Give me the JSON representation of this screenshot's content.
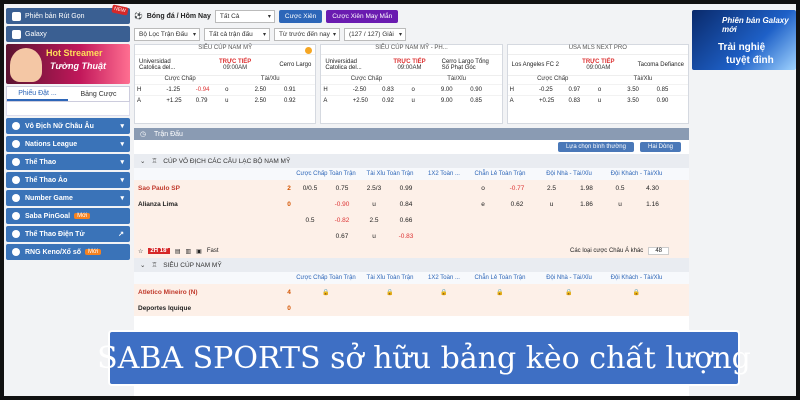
{
  "sidebar": {
    "promo_top": "Phiên bản Rút Gọn",
    "promo_new": "NEW",
    "galaxy": "Galaxy",
    "banner": {
      "line1": "Hot Streamer",
      "line2": "Tường Thuật"
    },
    "tabs": [
      "Phiếu Đặt ...",
      "Bảng Cược"
    ],
    "items": [
      {
        "label": "Vô Địch Nữ Châu Âu",
        "tag": ""
      },
      {
        "label": "Nations League",
        "tag": ""
      },
      {
        "label": "Thể Thao",
        "tag": ""
      },
      {
        "label": "Thể Thao Ảo",
        "tag": ""
      },
      {
        "label": "Number Game",
        "tag": ""
      },
      {
        "label": "Saba PinGoal",
        "tag": "Mới"
      },
      {
        "label": "Thể Thao Điện Tử",
        "tag": ""
      },
      {
        "label": "RNG Keno/Xổ số",
        "tag": "Mới"
      }
    ]
  },
  "topbar": {
    "title": "Bóng đá / Hôm Nay",
    "filter_all": "Tất Cả",
    "btn_parlay": "Cược Xiên",
    "btn_lucky": "Cược Xiên May Mắn",
    "filter_league": "Bộ Lọc Trận Đấu",
    "filter_matches": "Tất cả trận đấu",
    "filter_time": "Từ trước đến nay",
    "count": "(127 / 127) Giải"
  },
  "cards": [
    {
      "league": "SIÊU CÚP NAM MỸ",
      "home": "Universidad Catolica del...",
      "away": "Cerro Largo",
      "status": "TRỰC TIẾP",
      "time": "09:00AM",
      "sub1": "Cược Chấp",
      "sub2": "Tài/Xỉu",
      "rows": [
        [
          "H",
          "-1.25",
          "-0.94",
          "o",
          "2.50",
          "0.91"
        ],
        [
          "A",
          "+1.25",
          "0.79",
          "u",
          "2.50",
          "0.92"
        ]
      ]
    },
    {
      "league": "SIÊU CÚP NAM MỸ - PH...",
      "home": "Universidad Catolica del...",
      "away": "Cerro Largo Tổng Số Phạt Góc",
      "status": "TRỰC TIẾP",
      "time": "09:00AM",
      "sub1": "Cược Chấp",
      "sub2": "Tài/Xỉu",
      "rows": [
        [
          "H",
          "-2.50",
          "0.83",
          "o",
          "9.00",
          "0.90"
        ],
        [
          "A",
          "+2.50",
          "0.92",
          "u",
          "9.00",
          "0.85"
        ]
      ]
    },
    {
      "league": "USA MLS NEXT PRO",
      "home": "Los Angeles FC 2",
      "away": "Tacoma Defiance",
      "status": "TRỰC TIẾP",
      "time": "09:00AM",
      "sub1": "Cược Chấp",
      "sub2": "Tài/Xỉu",
      "rows": [
        [
          "H",
          "-0.25",
          "0.97",
          "o",
          "3.50",
          "0.85"
        ],
        [
          "A",
          "+0.25",
          "0.83",
          "u",
          "3.50",
          "0.90"
        ]
      ]
    }
  ],
  "right_banner": {
    "line1": "Phiên bản Galaxy mới",
    "line2": "Trải nghiệ",
    "line3": "tuyệt đỉnh"
  },
  "main": {
    "section": "Trận Đấu",
    "sel_odds": "Lựa chọn bình thường",
    "sel_odds_type": "Hai Dòng",
    "league1": "CÚP VÔ ĐỊCH CÁC CÂU LẠC BỘ NAM MỸ",
    "league2": "SIÊU CÚP NAM MỸ",
    "columns": [
      "Cược Chấp Toàn Trận",
      "Tài Xỉu Toàn Trận",
      "1X2 Toàn ...",
      "Chẵn Lẻ Toàn Trận",
      "Đội Nhà - Tài/Xỉu",
      "Đội Khách - Tài/Xỉu"
    ],
    "match1": {
      "home": "Sao Paulo SP",
      "away": "Alianza Lima",
      "home_score": "2",
      "away_score": "0",
      "rows": [
        [
          "0/0.5",
          "0.75",
          "2.5/3",
          "0.99",
          "",
          "o",
          "-0.77",
          "2.5",
          "1.98",
          "0.5",
          "4.30"
        ],
        [
          "",
          "-0.90",
          "u",
          "0.84",
          "",
          "e",
          "0.62",
          "u",
          "1.86",
          "u",
          "1.16"
        ],
        [
          "0.5",
          "-0.82",
          "2.5",
          "0.66",
          "",
          "",
          "",
          "",
          "",
          "",
          ""
        ],
        [
          "",
          "0.67",
          "u",
          "-0.83",
          "",
          "",
          "",
          "",
          "",
          "",
          ""
        ]
      ],
      "live": "2H 18'",
      "fast": "Fast",
      "odds_type": "Các loại cược Châu Á khác",
      "more": "48"
    },
    "match2": {
      "home": "Atletico Mineiro (N)",
      "away": "Deportes Iquique",
      "home_score": "4",
      "away_score": "0"
    }
  },
  "caption": "SABA SPORTS  sở hữu bảng kèo chất lượng"
}
